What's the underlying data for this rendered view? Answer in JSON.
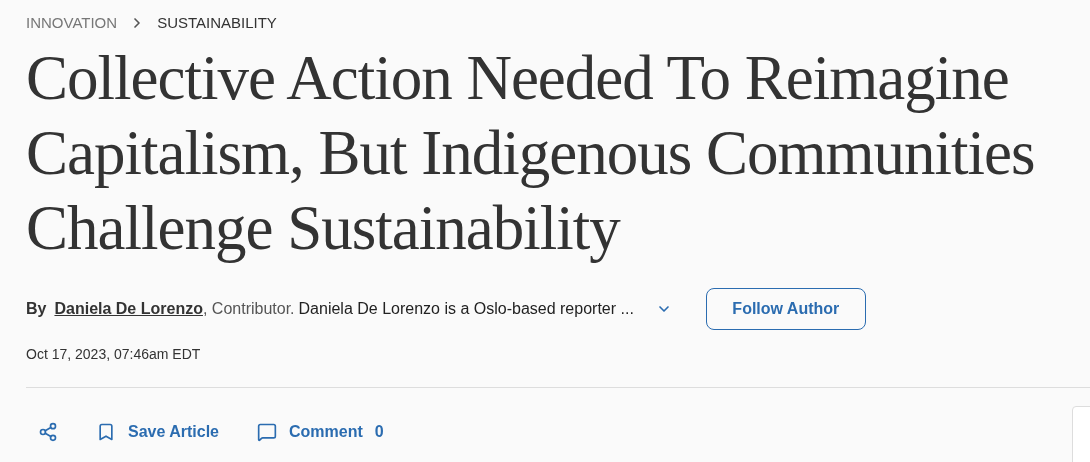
{
  "breadcrumb": [
    {
      "label": "INNOVATION",
      "selected": false
    },
    {
      "label": "SUSTAINABILITY",
      "selected": true
    }
  ],
  "headline": "Collective Action Needed To Reimagine Capitalism, But Indigenous Communities Challenge Sustainability",
  "byline": {
    "prefix": "By",
    "author": "Daniela De Lorenzo",
    "role": ", Contributor.",
    "bio": "Daniela De Lorenzo is a Oslo-based reporter ...",
    "follow_button": "Follow Author"
  },
  "date": "Oct 17, 2023, 07:46am EDT",
  "actions": [
    {
      "kind": "share"
    },
    {
      "kind": "save",
      "label": "Save Article"
    },
    {
      "kind": "comment",
      "label": "Comment",
      "count": "0"
    }
  ]
}
